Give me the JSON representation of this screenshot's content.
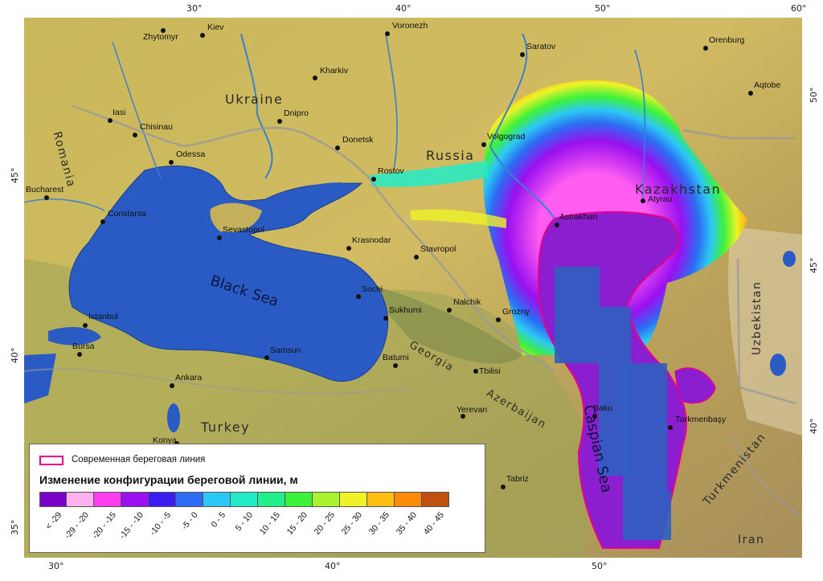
{
  "map": {
    "lon_ticks_top": [
      "30°",
      "40°",
      "50°",
      "60°"
    ],
    "lon_ticks_bottom": [
      "30°",
      "40°",
      "50°"
    ],
    "lat_ticks_left": [
      "45°",
      "40°",
      "35°"
    ],
    "lat_ticks_right": [
      "50°",
      "45°",
      "40°"
    ],
    "water_labels": {
      "black_sea": "Black Sea",
      "caspian_sea": "Caspian Sea"
    },
    "country_labels": {
      "ukraine": "Ukraine",
      "russia": "Russia",
      "kazakhstan": "Kazakhstan",
      "romania": "Romania",
      "turkey": "Turkey",
      "georgia": "Georgia",
      "azerbaijan": "Azerbaijan",
      "turkmenistan": "Turkmenistan",
      "uzbekistan": "Uzbekistan",
      "iran": "Iran"
    },
    "cities": [
      "Zhytomyr",
      "Kiev",
      "Voronezh",
      "Saratov",
      "Orenburg",
      "Kharkiv",
      "Aqtobe",
      "Iasi",
      "Chisinau",
      "Dnipro",
      "Donetsk",
      "Volgograd",
      "Odessa",
      "Rostov",
      "Bucharest",
      "Constanta",
      "Atyrau",
      "Astrakhan",
      "Sevastopol",
      "Krasnodar",
      "Stavropol",
      "Sochi",
      "Sukhumi",
      "Nalchik",
      "Grozny",
      "Istanbul",
      "Bursa",
      "Samsun",
      "Batumi",
      "Tbilisi",
      "Ankara",
      "Yerevan",
      "Baku",
      "Turkmenbaşy",
      "Konya",
      "Tabriz"
    ]
  },
  "legend": {
    "shoreline_label": "Современная береговая линия",
    "title": "Изменение конфигурации береговой линии, м",
    "classes": [
      {
        "label": "< -29",
        "color": "#7a00c8"
      },
      {
        "label": "-29 - -20",
        "color": "#ffb0ee"
      },
      {
        "label": "-20 - -15",
        "color": "#ff3ef0"
      },
      {
        "label": "-15 - -10",
        "color": "#9a10f0"
      },
      {
        "label": "-10 - -5",
        "color": "#3a1cf0"
      },
      {
        "label": "-5 - 0",
        "color": "#2c6cf2"
      },
      {
        "label": "0 - 5",
        "color": "#2cc8f4"
      },
      {
        "label": "5 - 10",
        "color": "#22ecc8"
      },
      {
        "label": "10 - 15",
        "color": "#22f08a"
      },
      {
        "label": "15 - 20",
        "color": "#3ef23a"
      },
      {
        "label": "20 - 25",
        "color": "#a8f22e"
      },
      {
        "label": "25 - 30",
        "color": "#eef228"
      },
      {
        "label": "30 - 35",
        "color": "#ffbe10"
      },
      {
        "label": "35 - 40",
        "color": "#ff8a08"
      },
      {
        "label": "40 - 45",
        "color": "#c05010"
      }
    ]
  },
  "colors": {
    "land": "#c9b45a",
    "sea": "#2a5bc4",
    "caspian": "#8b1fd0",
    "shoreline": "#e6008a",
    "river": "#3a7fd0"
  }
}
